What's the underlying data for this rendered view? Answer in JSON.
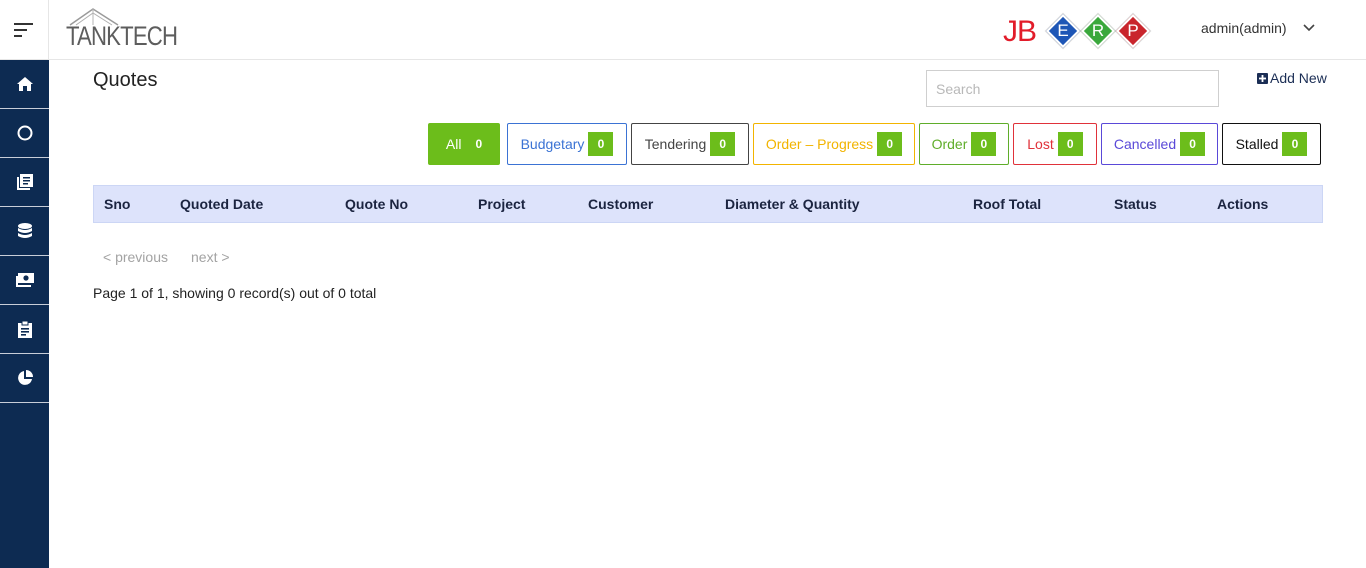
{
  "brand": {
    "name": "TANKTECH"
  },
  "erp_logo": {
    "prefix": "JB",
    "letters": [
      {
        "letter": "E",
        "color": "#1e56b6"
      },
      {
        "letter": "R",
        "color": "#3aa83c"
      },
      {
        "letter": "P",
        "color": "#c9252c"
      }
    ]
  },
  "user": {
    "name": "admin(admin)"
  },
  "sidebar": {
    "items": [
      {
        "icon": "home-icon"
      },
      {
        "icon": "circle-icon"
      },
      {
        "icon": "book-icon"
      },
      {
        "icon": "database-icon"
      },
      {
        "icon": "money-icon"
      },
      {
        "icon": "clipboard-icon"
      },
      {
        "icon": "pie-chart-icon"
      }
    ]
  },
  "page": {
    "title": "Quotes",
    "search_placeholder": "Search",
    "add_new": "Add New"
  },
  "filters": [
    {
      "label": "All",
      "count": "0",
      "color": "#6cbd1b",
      "active": true
    },
    {
      "label": "Budgetary",
      "count": "0",
      "color": "#3b73d4"
    },
    {
      "label": "Tendering",
      "count": "0",
      "color": "#444444"
    },
    {
      "label": "Order – Progress",
      "count": "0",
      "color": "#f2b400"
    },
    {
      "label": "Order",
      "count": "0",
      "color": "#5fad2a"
    },
    {
      "label": "Lost",
      "count": "0",
      "color": "#e0323a"
    },
    {
      "label": "Cancelled",
      "count": "0",
      "color": "#5a49d8"
    },
    {
      "label": "Stalled",
      "count": "0",
      "color": "#111111"
    }
  ],
  "table": {
    "columns": [
      "Sno",
      "Quoted Date",
      "Quote No",
      "Project",
      "Customer",
      "Diameter & Quantity",
      "Roof Total",
      "Status",
      "Actions"
    ]
  },
  "pagination": {
    "previous": "< previous",
    "next": "next >",
    "summary": "Page 1 of 1, showing 0 record(s) out of 0 total"
  }
}
